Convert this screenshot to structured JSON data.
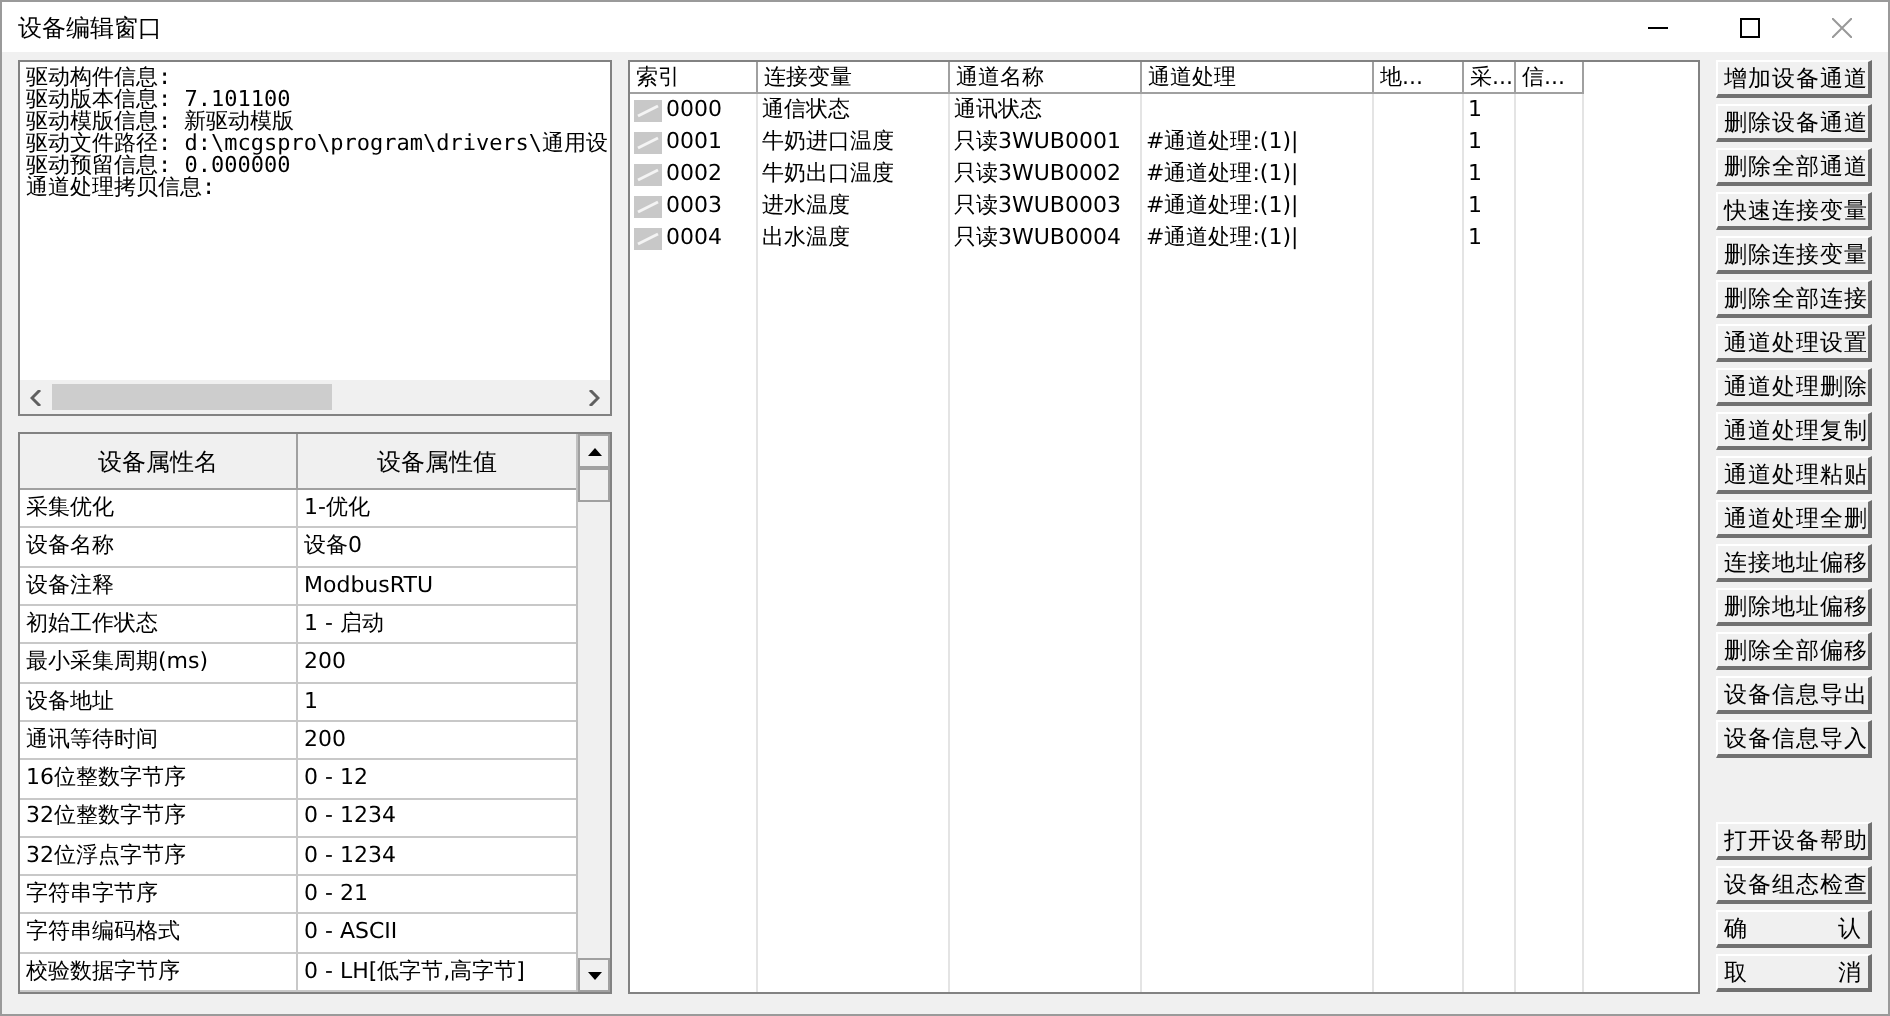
{
  "window": {
    "title": "设备编辑窗口"
  },
  "info_lines": [
    "驱动构件信息:",
    "驱动版本信息: 7.101100",
    "驱动模版信息: 新驱动模版",
    "驱动文件路径: d:\\mcgspro\\program\\drivers\\通用设",
    "驱动预留信息: 0.000000",
    "通道处理拷贝信息:"
  ],
  "properties": {
    "columns": [
      "设备属性名",
      "设备属性值"
    ],
    "rows": [
      [
        "采集优化",
        "1-优化"
      ],
      [
        "设备名称",
        "设备0"
      ],
      [
        "设备注释",
        "ModbusRTU"
      ],
      [
        "初始工作状态",
        "1 - 启动"
      ],
      [
        "最小采集周期(ms)",
        "200"
      ],
      [
        "设备地址",
        "1"
      ],
      [
        "通讯等待时间",
        "200"
      ],
      [
        "16位整数字节序",
        "0 - 12"
      ],
      [
        "32位整数字节序",
        "0 - 1234"
      ],
      [
        "32位浮点字节序",
        "0 - 1234"
      ],
      [
        "字符串字节序",
        "0 - 21"
      ],
      [
        "字符串编码格式",
        "0 - ASCII"
      ],
      [
        "校验数据字节序",
        "0 - LH[低字节,高字节]"
      ]
    ]
  },
  "channels": {
    "columns": [
      "索引",
      "连接变量",
      "通道名称",
      "通道处理",
      "地...",
      "采...",
      "信..."
    ],
    "rows": [
      [
        "0000",
        "通信状态",
        "通讯状态",
        "",
        "",
        "1",
        ""
      ],
      [
        "0001",
        "牛奶进口温度",
        "只读3WUB0001",
        "#通道处理:(1)|",
        "",
        "1",
        ""
      ],
      [
        "0002",
        "牛奶出口温度",
        "只读3WUB0002",
        "#通道处理:(1)|",
        "",
        "1",
        ""
      ],
      [
        "0003",
        "进水温度",
        "只读3WUB0003",
        "#通道处理:(1)|",
        "",
        "1",
        ""
      ],
      [
        "0004",
        "出水温度",
        "只读3WUB0004",
        "#通道处理:(1)|",
        "",
        "1",
        ""
      ]
    ]
  },
  "channel_buttons": [
    "增加设备通道",
    "删除设备通道",
    "删除全部通道",
    "快速连接变量",
    "删除连接变量",
    "删除全部连接",
    "通道处理设置",
    "通道处理删除",
    "通道处理复制",
    "通道处理粘贴",
    "通道处理全删",
    "连接地址偏移",
    "删除地址偏移",
    "删除全部偏移",
    "设备信息导出",
    "设备信息导入"
  ],
  "dialog_buttons": [
    "打开设备帮助",
    "设备组态检查",
    "确 认",
    "取 消"
  ]
}
